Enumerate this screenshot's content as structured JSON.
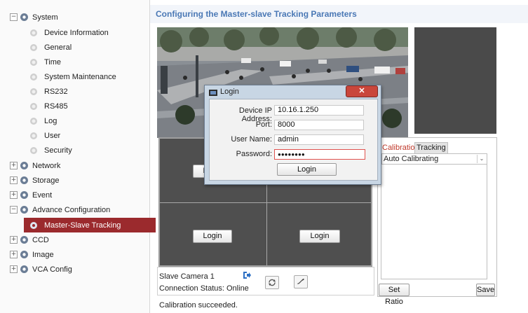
{
  "sidebar": {
    "items": [
      {
        "label": "System",
        "expander": "−",
        "level": "top"
      },
      {
        "label": "Device Information",
        "level": "child"
      },
      {
        "label": "General",
        "level": "child"
      },
      {
        "label": "Time",
        "level": "child"
      },
      {
        "label": "System Maintenance",
        "level": "child"
      },
      {
        "label": "RS232",
        "level": "child"
      },
      {
        "label": "RS485",
        "level": "child"
      },
      {
        "label": "Log",
        "level": "child"
      },
      {
        "label": "User",
        "level": "child"
      },
      {
        "label": "Security",
        "level": "child"
      },
      {
        "label": "Network",
        "expander": "+",
        "level": "top"
      },
      {
        "label": "Storage",
        "expander": "+",
        "level": "top"
      },
      {
        "label": "Event",
        "expander": "+",
        "level": "top"
      },
      {
        "label": "Advance Configuration",
        "expander": "−",
        "level": "top"
      },
      {
        "label": "Master-Slave Tracking",
        "level": "selected"
      },
      {
        "label": "CCD",
        "expander": "+",
        "level": "top"
      },
      {
        "label": "Image",
        "expander": "+",
        "level": "top"
      },
      {
        "label": "VCA Config",
        "expander": "+",
        "level": "top"
      }
    ]
  },
  "main": {
    "title": "Configuring the Master-slave Tracking Parameters",
    "grid_login_label": "Login",
    "slave_camera": "Slave Camera 1",
    "connection_status": "Connection Status: Online",
    "status_message": "Calibration succeeded."
  },
  "calibration": {
    "tab_calibration": "Calibration",
    "tab_tracking": "Tracking",
    "mode_select": "Auto Calibrating",
    "set_ratio": "Set Ratio",
    "save": "Save"
  },
  "dialog": {
    "title": "Login",
    "ip_label": "Device IP Address:",
    "ip_value": "10.16.1.250",
    "port_label": "Port:",
    "port_value": "8000",
    "user_label": "User Name:",
    "user_value": "admin",
    "password_label": "Password:",
    "password_value": "●●●●●●●●",
    "login_button": "Login",
    "close_icon": "close-icon"
  },
  "colors": {
    "accent": "#4a78b5",
    "selected": "#9b2a2d",
    "tab_active": "#c0392b"
  }
}
